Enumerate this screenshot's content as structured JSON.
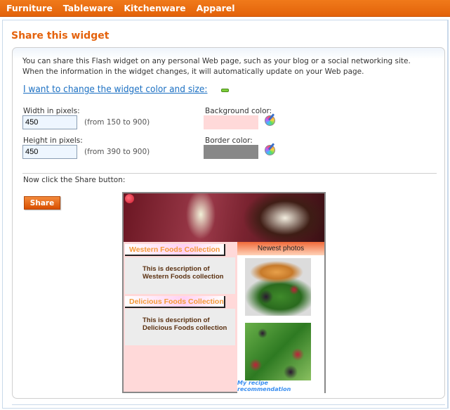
{
  "nav": {
    "items": [
      {
        "label": "Furniture"
      },
      {
        "label": "Tableware"
      },
      {
        "label": "Kitchenware"
      },
      {
        "label": "Apparel"
      }
    ]
  },
  "page": {
    "title": "Share this widget",
    "intro_line1": "You can share this Flash widget on any personal Web page, such as your blog or a social networking site.",
    "intro_line2": "When the information in the widget changes, it will automatically update on your Web page.",
    "change_link": "I want to change the widget color and size:",
    "collapse_icon": "minus-icon"
  },
  "form": {
    "width_label": "Width in pixels:",
    "width_value": "450",
    "width_hint": "(from 150 to 900)",
    "height_label": "Height in pixels:",
    "height_value": "450",
    "height_hint": "(from 390 to 900)",
    "bg_color_label": "Background color:",
    "bg_color": "#ffd9d9",
    "border_color_label": "Border color:",
    "border_color": "#888888",
    "picker_icon": "color-picker-icon"
  },
  "share": {
    "instruction": "Now click the Share button:",
    "button_label": "Share"
  },
  "widget": {
    "collections": [
      {
        "title": "Western Foods Collection",
        "description": "This is description of Western Foods collection"
      },
      {
        "title": "Delicious Foods Collection",
        "description": "This is description of Delicious Foods collection"
      }
    ],
    "newest_title": "Newest photos",
    "footer_link": "My recipe recommendation"
  },
  "colors": {
    "accent": "#e4620c",
    "link": "#1a6fc2"
  }
}
